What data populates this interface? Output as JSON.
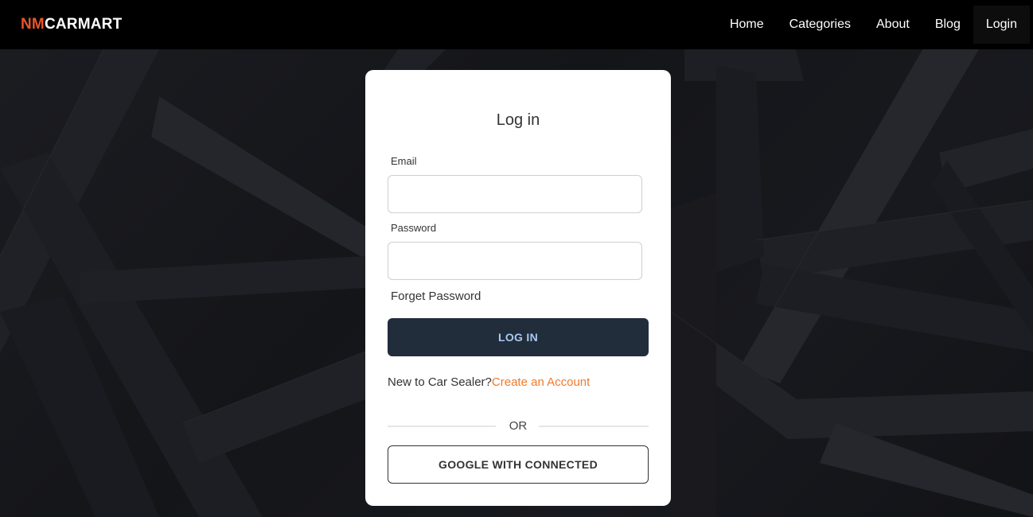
{
  "brand": {
    "prefix": "NM",
    "name": "CARMART",
    "accent_color": "#e8542a"
  },
  "nav": {
    "items": [
      {
        "label": "Home"
      },
      {
        "label": "Categories"
      },
      {
        "label": "About"
      },
      {
        "label": "Blog"
      },
      {
        "label": "Login",
        "active": true
      }
    ]
  },
  "login_card": {
    "title": "Log in",
    "email_label": "Email",
    "email_value": "",
    "password_label": "Password",
    "password_value": "",
    "forgot_password": "Forget Password",
    "login_button": "LOG IN",
    "signup_prompt": "New to Car Sealer?",
    "signup_link": "Create an Account",
    "divider_text": "OR",
    "google_button": "GOOGLE WITH CONNECTED"
  },
  "colors": {
    "navbar_bg": "#000000",
    "login_button_bg": "#212d3b",
    "link_color": "#f07a2a"
  }
}
